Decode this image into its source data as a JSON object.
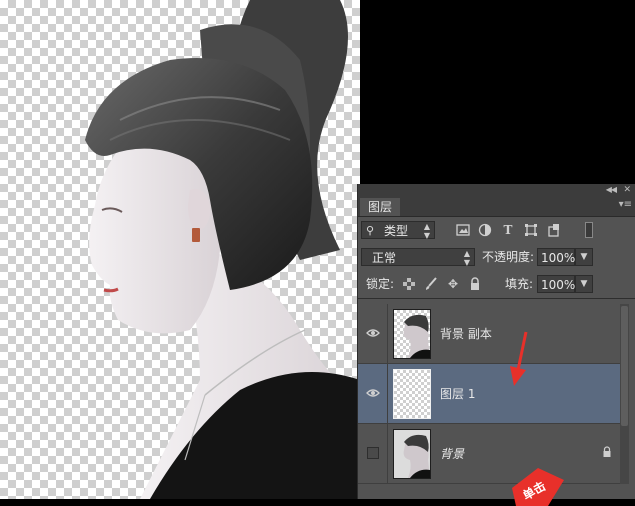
{
  "panel": {
    "tab_label": "图层",
    "filter": {
      "label": "类型"
    },
    "blend_mode": "正常",
    "opacity_label": "不透明度:",
    "opacity_value": "100%",
    "lock_label": "锁定:",
    "fill_label": "填充:",
    "fill_value": "100%"
  },
  "layers": [
    {
      "name": "背景 副本",
      "visible": true,
      "selected": false,
      "locked": false
    },
    {
      "name": "图层 1",
      "visible": true,
      "selected": true,
      "locked": false
    },
    {
      "name": "背景",
      "visible": false,
      "selected": false,
      "locked": true,
      "italic": true
    }
  ],
  "annotation": {
    "badge_text": "单击"
  },
  "colors": {
    "panel_bg": "#535353",
    "selected_row": "#5b6a80",
    "annotation_red": "#e8302a"
  },
  "icons": [
    "search-icon",
    "image-filter-icon",
    "adjust-filter-icon",
    "type-filter-icon",
    "shape-filter-icon",
    "smart-filter-icon",
    "eye-icon",
    "lock-icon"
  ]
}
